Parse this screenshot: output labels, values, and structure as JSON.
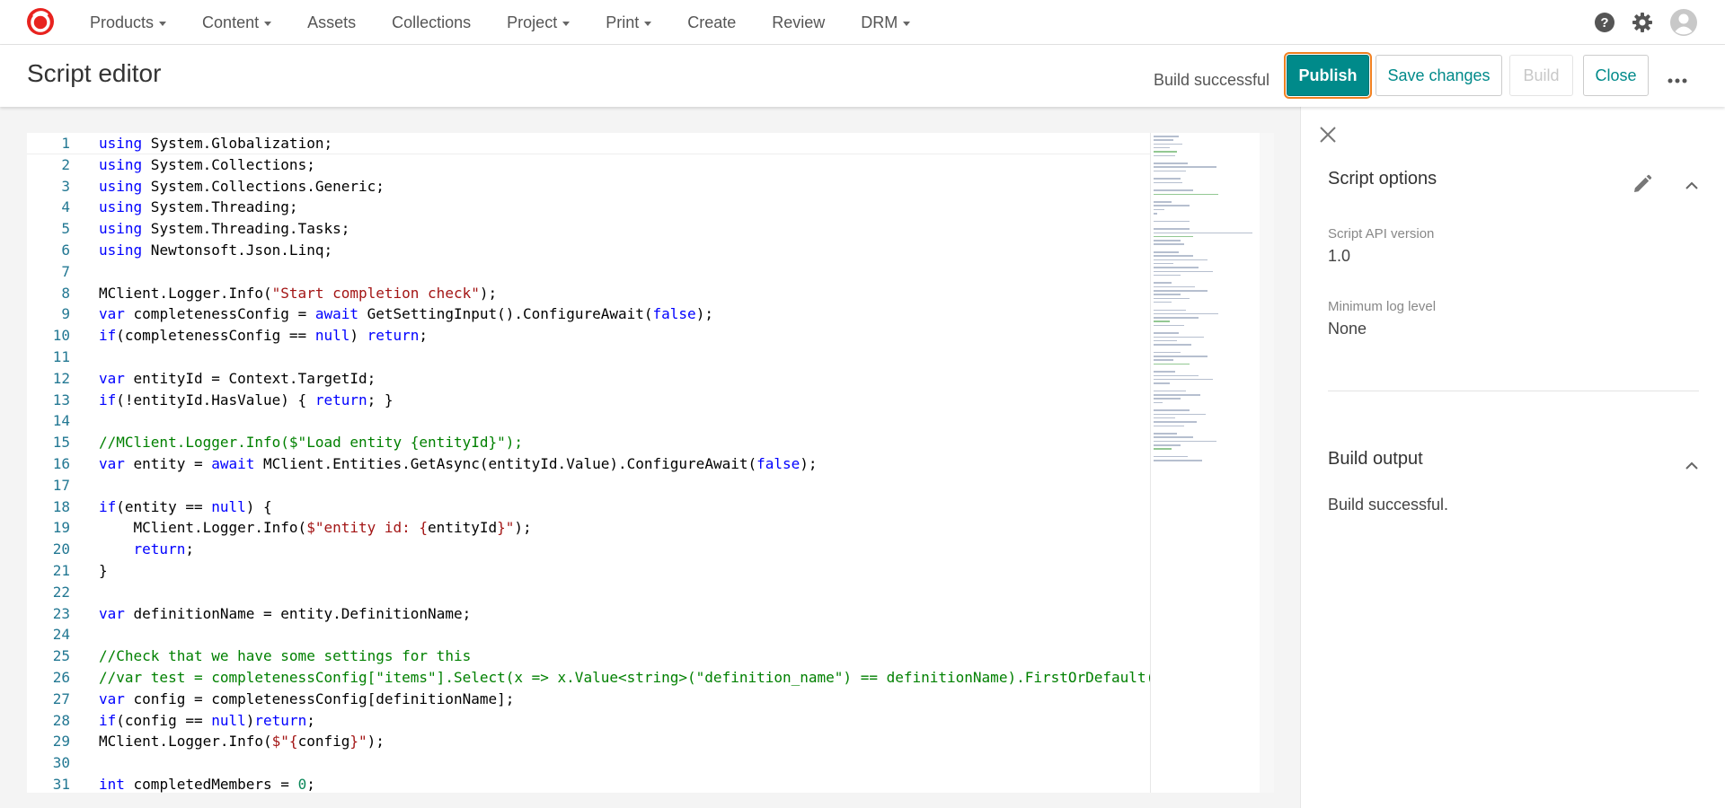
{
  "nav": {
    "items": [
      {
        "label": "Products",
        "dropdown": true
      },
      {
        "label": "Content",
        "dropdown": true
      },
      {
        "label": "Assets",
        "dropdown": false
      },
      {
        "label": "Collections",
        "dropdown": false
      },
      {
        "label": "Project",
        "dropdown": true
      },
      {
        "label": "Print",
        "dropdown": true
      },
      {
        "label": "Create",
        "dropdown": false
      },
      {
        "label": "Review",
        "dropdown": false
      },
      {
        "label": "DRM",
        "dropdown": true
      }
    ],
    "icons": [
      "help-icon",
      "gear-icon",
      "user-avatar-icon"
    ]
  },
  "header": {
    "title": "Script editor",
    "build_status": "Build successful",
    "publish_label": "Publish",
    "save_label": "Save changes",
    "build_label": "Build",
    "close_label": "Close"
  },
  "editor": {
    "lines": [
      "<span class=\"kw\">using</span> System.Globalization;",
      "<span class=\"kw\">using</span> System.Collections;",
      "<span class=\"kw\">using</span> System.Collections.Generic;",
      "<span class=\"kw\">using</span> System.Threading;",
      "<span class=\"kw\">using</span> System.Threading.Tasks;",
      "<span class=\"kw\">using</span> Newtonsoft.Json.Linq;",
      "",
      "MClient.Logger.Info(<span class=\"str\">\"Start completion check\"</span>);",
      "<span class=\"kw\">var</span> completenessConfig = <span class=\"kw\">await</span> GetSettingInput().ConfigureAwait(<span class=\"kw\">false</span>);",
      "<span class=\"kw\">if</span>(completenessConfig == <span class=\"kw\">null</span>) <span class=\"kw\">return</span>;",
      "",
      "<span class=\"kw\">var</span> entityId = Context.TargetId;",
      "<span class=\"kw\">if</span>(!entityId.HasValue) { <span class=\"kw\">return</span>; }",
      "",
      "<span class=\"cm\">//MClient.Logger.Info($\"Load entity {entityId}\");</span>",
      "<span class=\"kw\">var</span> entity = <span class=\"kw\">await</span> MClient.Entities.GetAsync(entityId.Value).ConfigureAwait(<span class=\"kw\">false</span>);",
      "",
      "<span class=\"kw\">if</span>(entity == <span class=\"kw\">null</span>) {",
      "    MClient.Logger.Info(<span class=\"str\">$\"entity id: {</span>entityId<span class=\"str\">}\"</span>);",
      "    <span class=\"kw\">return</span>;",
      "}",
      "",
      "<span class=\"kw\">var</span> definitionName = entity.DefinitionName;",
      "",
      "<span class=\"cm\">//Check that we have some settings for this</span>",
      "<span class=\"cm\">//var test = completenessConfig[\"items\"].Select(x =&gt; x.Value&lt;string&gt;(\"definition_name\") == definitionName).FirstOrDefault(</span>",
      "<span class=\"kw\">var</span> config = completenessConfig[definitionName];",
      "<span class=\"kw\">if</span>(config == <span class=\"kw\">null</span>)<span class=\"kw\">return</span>;",
      "MClient.Logger.Info(<span class=\"str\">$\"{</span>config<span class=\"str\">}\"</span>);",
      "",
      "<span class=\"kw\">int</span> completedMembers = <span class=\"num\">0</span>;"
    ]
  },
  "panel": {
    "script_options_title": "Script options",
    "api_version_label": "Script API version",
    "api_version_value": "1.0",
    "log_level_label": "Minimum log level",
    "log_level_value": "None",
    "build_output_title": "Build output",
    "build_output_text": "Build successful."
  },
  "colors": {
    "accent": "#008a8a",
    "focus_outline": "#f08020",
    "logo": "#e8231f"
  }
}
